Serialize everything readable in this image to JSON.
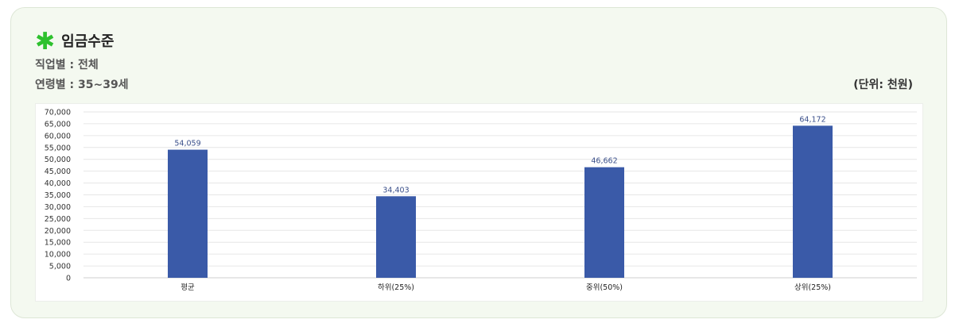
{
  "header": {
    "title": "임금수준",
    "occupation": "직업별 : 전체",
    "age_group": "연령별 : 35~39세",
    "unit": "(단위: 천원)"
  },
  "colors": {
    "bar": "#3a5aa8",
    "accent": "#2ec12e",
    "card_bg": "#f4f9f0"
  },
  "chart_data": {
    "type": "bar",
    "categories": [
      "평균",
      "하위(25%)",
      "중위(50%)",
      "상위(25%)"
    ],
    "values": [
      54059,
      34403,
      46662,
      64172
    ],
    "value_labels": [
      "54,059",
      "34,403",
      "46,662",
      "64,172"
    ],
    "ylim": [
      0,
      70000
    ],
    "yticks": [
      "0",
      "5,000",
      "10,000",
      "15,000",
      "20,000",
      "25,000",
      "30,000",
      "35,000",
      "40,000",
      "45,000",
      "50,000",
      "55,000",
      "60,000",
      "65,000",
      "70,000"
    ],
    "grid": true
  }
}
